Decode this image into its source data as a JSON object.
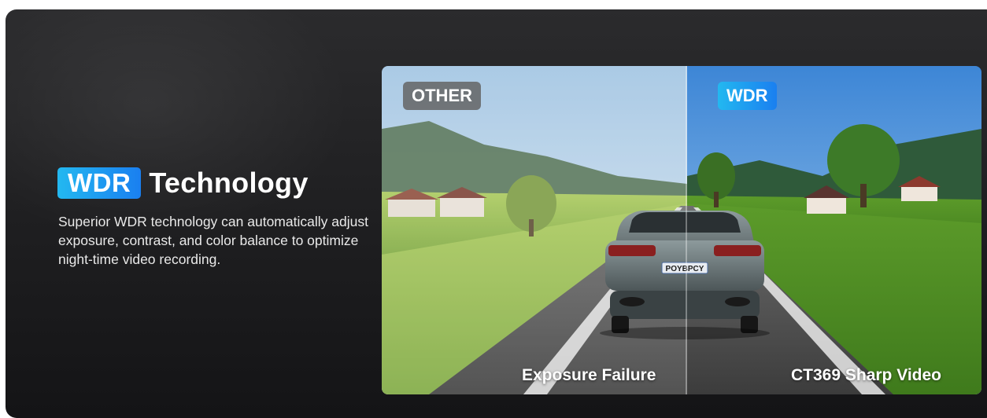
{
  "heading": {
    "badge": "WDR",
    "title": "Technology"
  },
  "description": "Superior WDR technology can automatically adjust exposure, contrast, and color balance to optimize night-time video recording.",
  "comparison": {
    "left_tag": "OTHER",
    "right_tag": "WDR",
    "left_caption": "Exposure Failure",
    "right_caption": "CT369 Sharp Video",
    "license_plate": "POYBPCY"
  },
  "colors": {
    "accent_gradient_start": "#23b8f0",
    "accent_gradient_end": "#1a7ff0",
    "background": "#1e1e20"
  }
}
